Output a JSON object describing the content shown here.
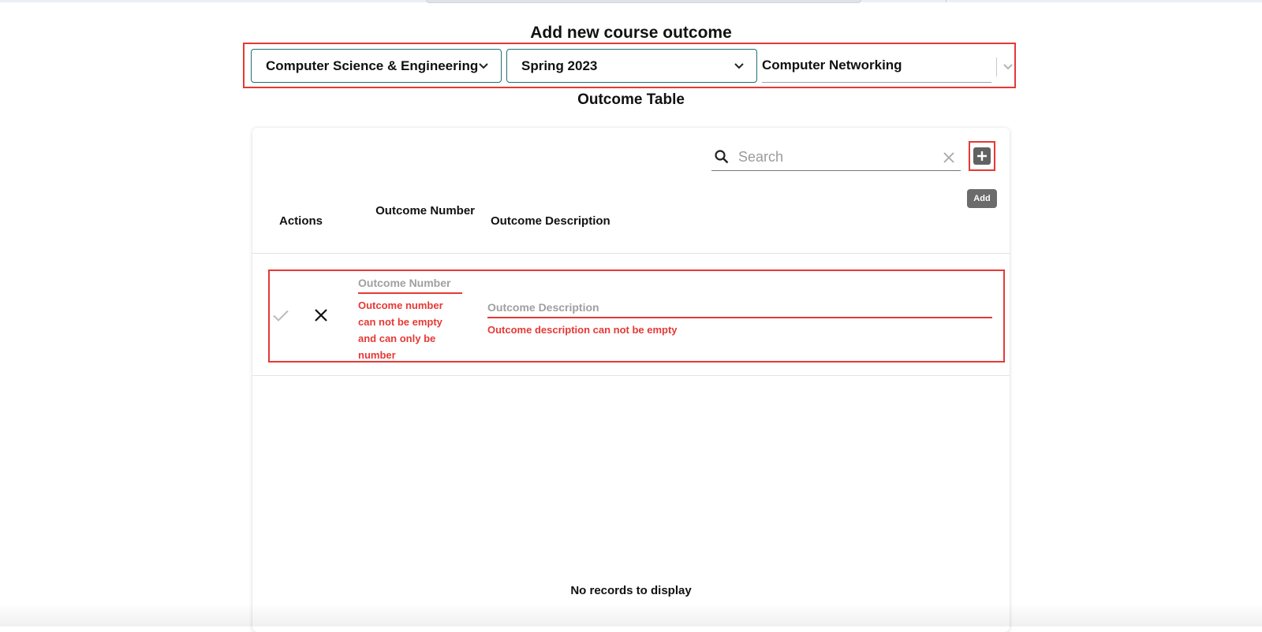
{
  "page": {
    "title": "Add new course outcome",
    "section_title": "Outcome Table"
  },
  "selectors": {
    "department": "Computer Science & Engineering",
    "term": "Spring 2023",
    "course": "Computer Networking"
  },
  "toolbar": {
    "search_placeholder": "Search",
    "add_tooltip": "Add"
  },
  "table": {
    "headers": {
      "actions": "Actions",
      "outcome_number": "Outcome Number",
      "outcome_description": "Outcome Description"
    },
    "edit_row": {
      "number_placeholder": "Outcome Number",
      "number_error": "Outcome number can not be empty and can only be number",
      "description_placeholder": "Outcome Description",
      "description_error": "Outcome description can not be empty"
    },
    "empty_message": "No records to display"
  },
  "icons": [
    "search-icon",
    "clear-icon",
    "plus-icon",
    "check-icon",
    "close-icon",
    "chevron-down-icon"
  ],
  "colors": {
    "accent": "#1f6f73",
    "error": "#e53935",
    "add_button": "#616161",
    "tooltip": "#6b6b6b"
  }
}
